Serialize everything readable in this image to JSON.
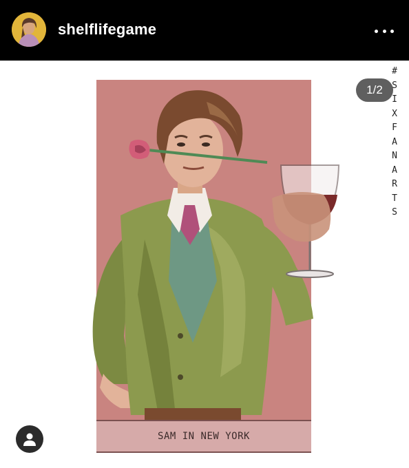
{
  "header": {
    "username": "shelflifegame",
    "avatar_icon": "avatar-icon",
    "more_icon": "more-options-icon"
  },
  "post": {
    "counter": "1/2",
    "caption": "SAM IN NEW YORK",
    "vertical_tag": [
      "#",
      "S",
      "I",
      "X",
      "F",
      "A",
      "N",
      "A",
      "R",
      "T",
      "S"
    ],
    "tag_icon": "user-tag-icon"
  },
  "colors": {
    "header_bg": "#000000",
    "card_bg": "#c98480",
    "caption_bg": "#d6aaa9",
    "jacket": "#8c9a4e",
    "vest": "#6e9884",
    "tie": "#b0517a",
    "hair": "#7a4a2f",
    "wine": "#7a2a2a"
  }
}
